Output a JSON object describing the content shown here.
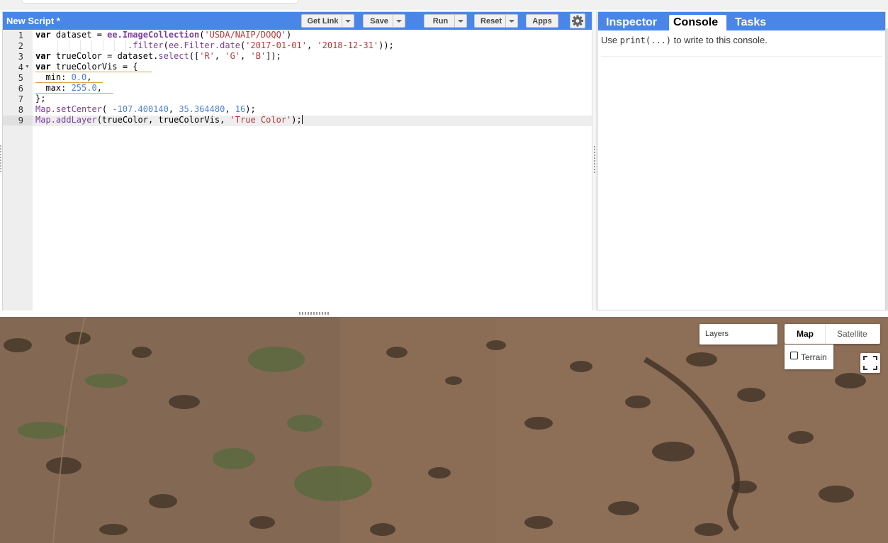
{
  "editor": {
    "title": "New Script *",
    "buttons": {
      "get_link": "Get Link",
      "save": "Save",
      "run": "Run",
      "reset": "Reset",
      "apps": "Apps"
    },
    "settings_icon": "gear-icon",
    "line_numbers": [
      "1",
      "2",
      "3",
      "4",
      "5",
      "6",
      "7",
      "8",
      "9"
    ],
    "active_line": 9
  },
  "code": [
    "var dataset = ee.ImageCollection('USDA/NAIP/DOQQ')",
    "                  .filter(ee.Filter.date('2017-01-01', '2018-12-31'));",
    "var trueColor = dataset.select(['R', 'G', 'B']);",
    "var trueColorVis = {",
    "  min: 0.0,",
    "  max: 255.0,",
    "};",
    "Map.setCenter( -107.400140, 35.364480, 16);",
    "Map.addLayer(trueColor, trueColorVis, 'True Color');"
  ],
  "right_panel": {
    "tabs": [
      {
        "label": "Inspector",
        "active": false
      },
      {
        "label": "Console",
        "active": true
      },
      {
        "label": "Tasks",
        "active": false
      }
    ],
    "console_message": {
      "prefix": "Use",
      "code": "print(...)",
      "suffix": "to write to this console."
    }
  },
  "map": {
    "layers_label": "Layers",
    "map_type_map": "Map",
    "map_type_satellite": "Satellite",
    "terrain_label": "Terrain",
    "terrain_checked": false,
    "fullscreen_icon": "fullscreen-icon",
    "colors": {
      "ground": "#8a6c55",
      "shrub": "#4a3b2c",
      "vegetation": "#5b6a3e"
    }
  },
  "colors": {
    "header_blue": "#4a86e8",
    "string_red": "#b3383a",
    "number_blue": "#4c82d6",
    "function_purple": "#7a3e9d"
  }
}
